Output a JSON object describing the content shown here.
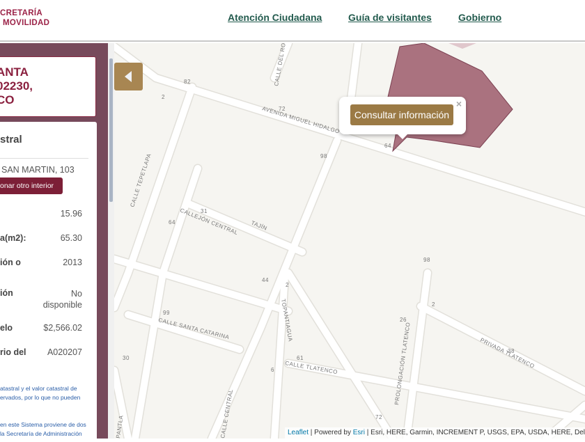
{
  "header": {
    "logo_line1": "CRETARÍA",
    "logo_line2": "MOVILIDAD",
    "nav": [
      "Atención Ciudadana",
      "Guía de visitantes",
      "Gobierno"
    ]
  },
  "sidebar": {
    "title_lines": [
      "ANTA",
      "02230,",
      "CO"
    ],
    "section_title": "stral",
    "address": "SAN MARTIN, 103",
    "select_other_label": "onar otro interior",
    "rows": [
      {
        "key": "",
        "value": "15.96"
      },
      {
        "key": "a(m2):",
        "value": "65.30"
      },
      {
        "key": "ión o",
        "value": "2013"
      },
      {
        "key": "ión",
        "value": "No disponible"
      },
      {
        "key": "elo",
        "value": "$2,566.02"
      },
      {
        "key": "rio del",
        "value": "A020207"
      }
    ],
    "note1": "atastral y el valor catastral de ervados, por lo que no pueden",
    "note2": "en este Sistema proviene de dos la Secretaría de Administración"
  },
  "map": {
    "popup_button": "Consultar información",
    "popup_close": "×",
    "labels": [
      "AVENIDA MIGUEL HIDALGO",
      "CALLE TEPETLAPA",
      "CALLEJÓN CENTRAL",
      "TAJÍN",
      "CALLE DEL RO",
      "CALLE SANTA CATARINA",
      "TOPANTIAGUA",
      "CALLE TLATENCO",
      "PROLONGACIÓN TLATENCO",
      "PRIVADA TLATENCO",
      "CALLE CENTRAL",
      "PANTLA",
      "82",
      "72",
      "64",
      "98",
      "2",
      "31",
      "64",
      "44",
      "2",
      "99",
      "30",
      "61",
      "26",
      "98",
      "2",
      "38",
      "72",
      "6"
    ],
    "attribution": {
      "leaflet": "Leaflet",
      "powered": " | Powered by ",
      "esri": "Esri",
      "rest": " | Esri, HERE, Garmin, INCREMENT P, USGS, EPA, USDA, HERE, Del"
    },
    "colors": {
      "parcel": "#9c5b6b",
      "accent": "#9b7a45"
    }
  }
}
